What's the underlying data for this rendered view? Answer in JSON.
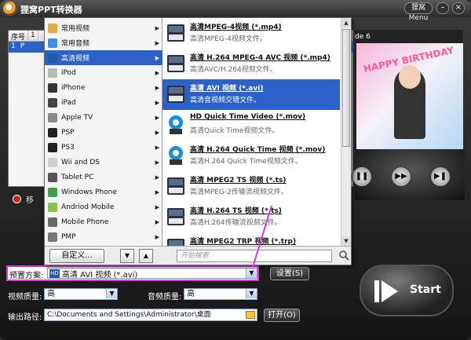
{
  "app": {
    "title": "狸窝PPT转换器",
    "menu_label": "狸窝Menu",
    "minimize_label": "–",
    "close_label": "×"
  },
  "file_list": {
    "columns": [
      "序号",
      "1"
    ],
    "row": {
      "index": "1",
      "name": "P"
    },
    "remove_label": "移"
  },
  "preview": {
    "label": "de 6",
    "image_text": "HAPPY BIRTHDAY"
  },
  "categories": [
    {
      "label": "常用视频",
      "icon": "film-icon",
      "selected": false
    },
    {
      "label": "常用音频",
      "icon": "audio-icon",
      "selected": false
    },
    {
      "label": "高清视频",
      "icon": "hd-icon",
      "selected": true
    },
    {
      "label": "iPod",
      "icon": "ipod-icon",
      "selected": false
    },
    {
      "label": "iPhone",
      "icon": "iphone-icon",
      "selected": false
    },
    {
      "label": "iPad",
      "icon": "ipad-icon",
      "selected": false
    },
    {
      "label": "Apple TV",
      "icon": "apple-icon",
      "selected": false
    },
    {
      "label": "PSP",
      "icon": "psp-icon",
      "selected": false
    },
    {
      "label": "PS3",
      "icon": "ps3-icon",
      "selected": false
    },
    {
      "label": "Wii and DS",
      "icon": "wii-icon",
      "selected": false
    },
    {
      "label": "Tablet PC",
      "icon": "tablet-icon",
      "selected": false
    },
    {
      "label": "Windows Phone",
      "icon": "windows-icon",
      "selected": false
    },
    {
      "label": "Andriod Mobile",
      "icon": "android-icon",
      "selected": false
    },
    {
      "label": "Mobile Phone",
      "icon": "mobile-icon",
      "selected": false
    },
    {
      "label": "PMP",
      "icon": "pmp-icon",
      "selected": false
    }
  ],
  "formats": [
    {
      "title": "高清MPEG-4视频 (*.mp4)",
      "desc": "高清MPEG-4视频文件。",
      "icon": "mp4-icon",
      "selected": false
    },
    {
      "title": "高清 H.264 MPEG-4 AVC 视频 (*.mp4)",
      "desc": "高清AVC/H.264视频文件。",
      "icon": "avc-icon",
      "selected": false
    },
    {
      "title": "高清 AVI 视频 (*.avi)",
      "desc": "高清音视频交错文件。",
      "icon": "avi-icon",
      "selected": true
    },
    {
      "title": "HD Quick Time Video (*.mov)",
      "desc": "高清Quick Time视频文件。",
      "icon": "quicktime-icon",
      "selected": false
    },
    {
      "title": "高清 H.264 Quick Time 视频 (*.mov)",
      "desc": "高清H.264 Quick Time视频文件。",
      "icon": "quicktime-h264-icon",
      "selected": false
    },
    {
      "title": "高清 MPEG2 TS 视频 (*.ts)",
      "desc": "高清MPEG-2传输流视频文件。",
      "icon": "ts-icon",
      "selected": false
    },
    {
      "title": "高清 H.264 TS 视频 (*.ts)",
      "desc": "高清H.264传输流视频文件。",
      "icon": "h264-ts-icon",
      "selected": false
    },
    {
      "title": "高清 MPEG2 TRP 视频 (*.trp)",
      "desc": "",
      "icon": "trp-icon",
      "selected": false
    }
  ],
  "popup_footer": {
    "custom_label": "自定义...",
    "move_down": "▼",
    "move_up": "▲",
    "search_placeholder": "开始搜索"
  },
  "settings": {
    "preset_label": "预置方案:",
    "preset_value": "高清 AVI 视频 (*.avi)",
    "settings_button": "设置(S)",
    "video_quality_label": "视频质量:",
    "video_quality_value": "高",
    "audio_quality_label": "音频质量:",
    "audio_quality_value": "高",
    "output_label": "输出路径:",
    "output_path": "C:\\Documents and Settings\\Administrator\\桌面",
    "open_button": "打开(O)",
    "start_label": "Start"
  },
  "colors": {
    "selection": "#2b61c9",
    "highlight_border": "#d63bd4"
  }
}
